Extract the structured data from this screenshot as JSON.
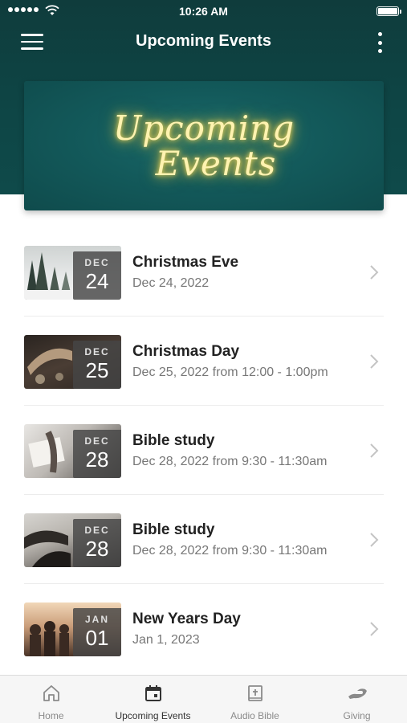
{
  "status_bar": {
    "time": "10:26 AM"
  },
  "header": {
    "title": "Upcoming Events"
  },
  "banner": {
    "line1": "Upcoming",
    "line2": "Events"
  },
  "events": [
    {
      "month": "DEC",
      "day": "24",
      "title": "Christmas Eve",
      "date": "Dec 24, 2022",
      "thumb": "snowy-forest"
    },
    {
      "month": "DEC",
      "day": "25",
      "title": "Christmas Day",
      "date": "Dec 25, 2022 from 12:00 - 1:00pm",
      "thumb": "christmas-sign"
    },
    {
      "month": "DEC",
      "day": "28",
      "title": "Bible study",
      "date": "Dec 28, 2022 from 9:30 - 11:30am",
      "thumb": "open-bible"
    },
    {
      "month": "DEC",
      "day": "28",
      "title": "Bible study",
      "date": "Dec 28, 2022 from 9:30 - 11:30am",
      "thumb": "reading-group"
    },
    {
      "month": "JAN",
      "day": "01",
      "title": "New Years Day",
      "date": "Jan 1, 2023",
      "thumb": "sunset-crowd"
    }
  ],
  "tab_bar": {
    "tabs": [
      {
        "label": "Home",
        "icon": "home-icon"
      },
      {
        "label": "Upcoming Events",
        "icon": "calendar-icon"
      },
      {
        "label": "Audio Bible",
        "icon": "bible-icon"
      },
      {
        "label": "Giving",
        "icon": "giving-hand-icon"
      }
    ],
    "active_index": 1
  },
  "colors": {
    "header_bg": "#0f4646",
    "banner_glow": "#f5d85a",
    "chevron": "#c4c4c4"
  }
}
